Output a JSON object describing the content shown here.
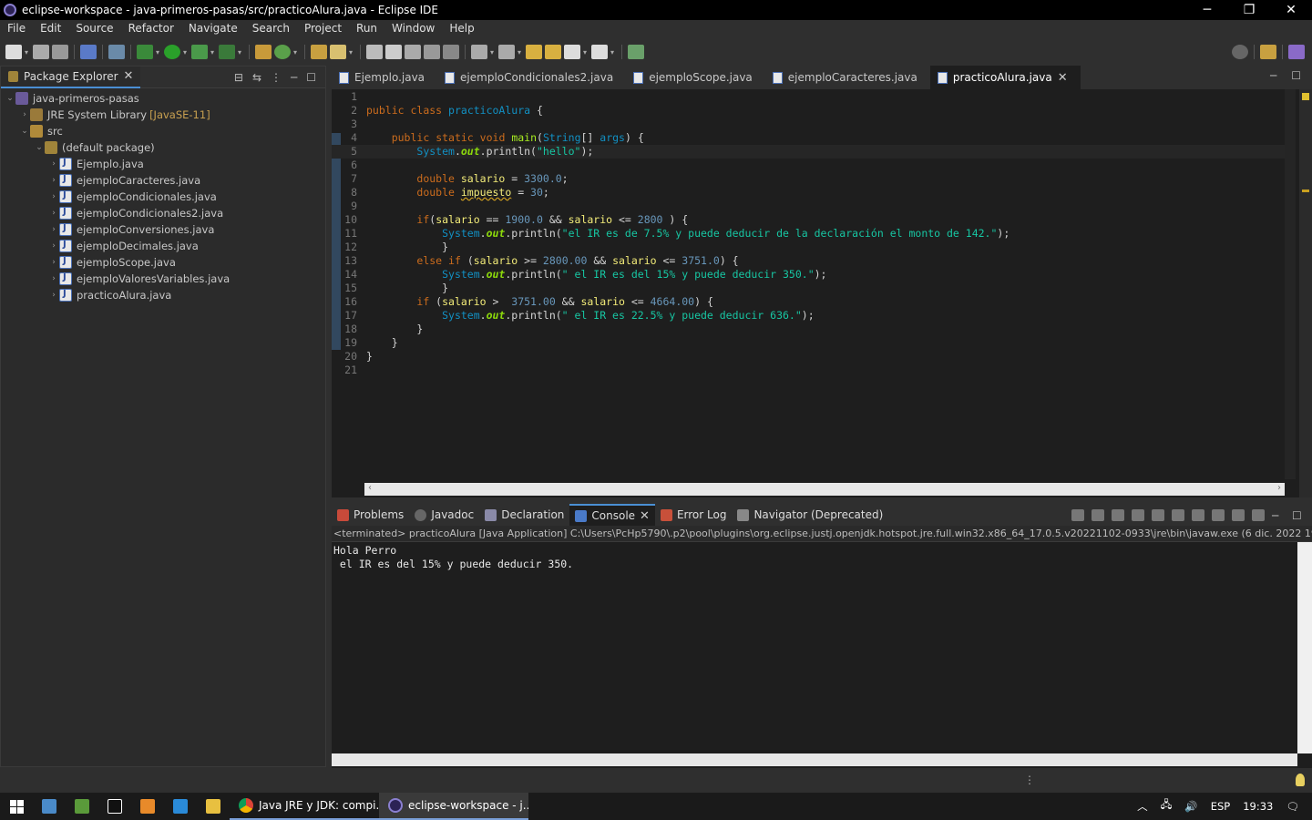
{
  "window": {
    "title": "eclipse-workspace - java-primeros-pasas/src/practicoAlura.java - Eclipse IDE",
    "minimize": "─",
    "restore": "❐",
    "close": "✕"
  },
  "menu": [
    "File",
    "Edit",
    "Source",
    "Refactor",
    "Navigate",
    "Search",
    "Project",
    "Run",
    "Window",
    "Help"
  ],
  "package_explorer": {
    "tab_label": "Package Explorer",
    "project": "java-primeros-pasas",
    "jre_label": "JRE System Library",
    "jre_version": "[JavaSE-11]",
    "src": "src",
    "default_package": "(default package)",
    "files": [
      "Ejemplo.java",
      "ejemploCaracteres.java",
      "ejemploCondicionales.java",
      "ejemploCondicionales2.java",
      "ejemploConversiones.java",
      "ejemploDecimales.java",
      "ejemploScope.java",
      "ejemploValoresVariables.java",
      "practicoAlura.java"
    ]
  },
  "editor": {
    "tabs": [
      {
        "label": "Ejemplo.java"
      },
      {
        "label": "ejemploCondicionales2.java"
      },
      {
        "label": "ejemploScope.java"
      },
      {
        "label": "ejemploCaracteres.java"
      },
      {
        "label": "practicoAlura.java",
        "active": true
      }
    ],
    "line_numbers": [
      "1",
      "2",
      "3",
      "4",
      "5",
      "6",
      "7",
      "8",
      "9",
      "10",
      "11",
      "12",
      "13",
      "14",
      "15",
      "16",
      "17",
      "18",
      "19",
      "20",
      "21"
    ]
  },
  "bottom_panel": {
    "tabs": [
      "Problems",
      "Javadoc",
      "Declaration",
      "Console",
      "Error Log",
      "Navigator (Deprecated)"
    ],
    "active_tab": "Console",
    "terminated_line": "<terminated> practicoAlura [Java Application] C:\\Users\\PcHp5790\\.p2\\pool\\plugins\\org.eclipse.justj.openjdk.hotspot.jre.full.win32.x86_64_17.0.5.v20221102-0933\\jre\\bin\\javaw.exe  (6 dic. 2022 19:32:13 – 19",
    "output": [
      "Hola Perro",
      " el IR es del 15% y puede deducir 350."
    ]
  },
  "taskbar": {
    "chrome_task": "Java JRE y JDK: compi...",
    "eclipse_task": "eclipse-workspace - j...",
    "language": "ESP",
    "time": "19:33"
  },
  "colors": {
    "keyword": "#cc6c1d",
    "string": "#17c6a3",
    "class": "#1290c3",
    "variable": "#f3ec79",
    "number": "#6897bb"
  }
}
